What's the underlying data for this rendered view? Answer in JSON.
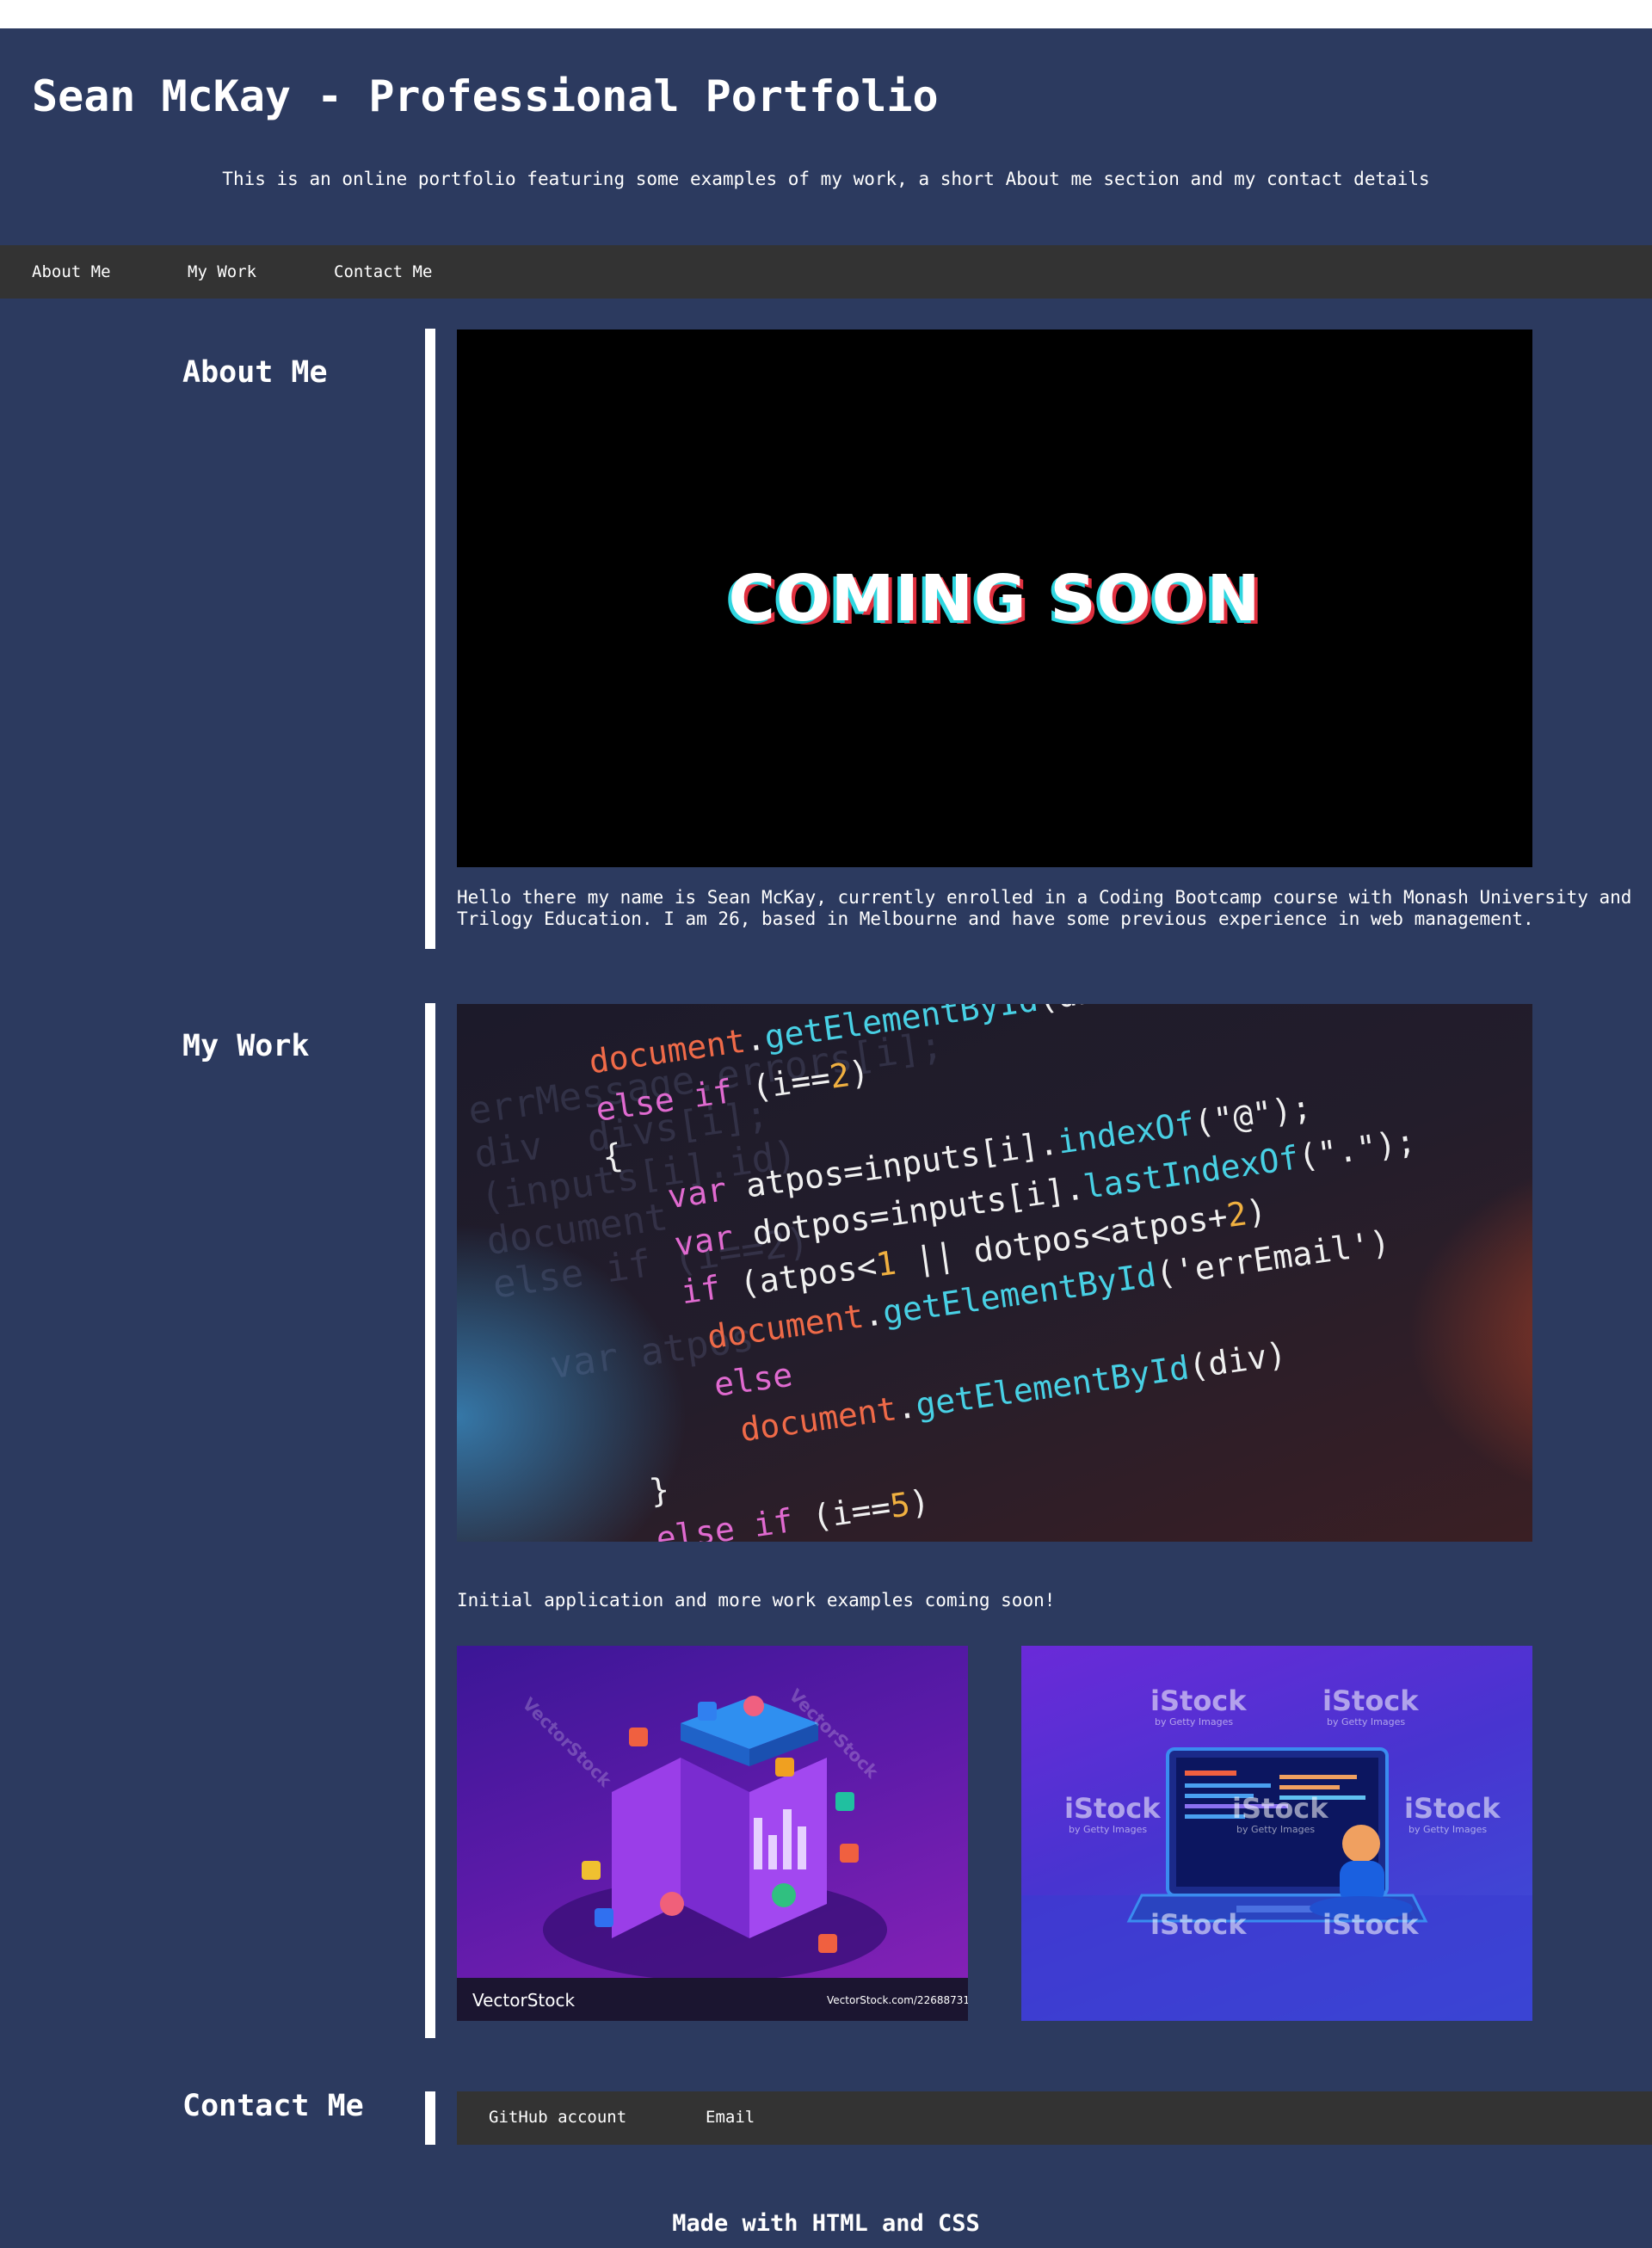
{
  "header": {
    "title": "Sean McKay - Professional Portfolio",
    "description": "This is an online portfolio featuring some examples of my work, a short About me section and my contact details"
  },
  "nav": {
    "items": [
      {
        "label": "About Me"
      },
      {
        "label": "My Work"
      },
      {
        "label": "Contact Me"
      }
    ]
  },
  "about": {
    "title": "About Me",
    "image_text": "COMING SOON",
    "bio_line1": "Hello there my name is Sean McKay, currently enrolled in a Coding Bootcamp course with Monash University and",
    "bio_line2": "Trilogy Education. I am 26, based in Melbourne and have some previous experience in web management."
  },
  "work": {
    "title": "My Work",
    "caption": "Initial application and more work examples coming soon!",
    "image1_watermark": "VectorStock",
    "image1_id": "VectorStock.com/22688731",
    "image2_watermark": "iStock",
    "image2_sub": "by Getty Images"
  },
  "contact": {
    "title": "Contact Me",
    "links": [
      {
        "label": "GitHub account"
      },
      {
        "label": "Email"
      }
    ]
  },
  "footer": {
    "text": "Made with HTML and CSS"
  },
  "colors": {
    "page_bg": "#2c3a5f",
    "nav_bg": "#333333",
    "text": "#ffffff",
    "accent_bar": "#ffffff"
  }
}
